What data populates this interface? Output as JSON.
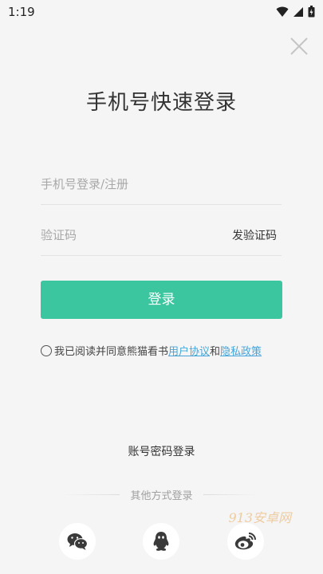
{
  "status_bar": {
    "time": "1:19"
  },
  "header": {
    "title": "手机号快速登录"
  },
  "form": {
    "phone_placeholder": "手机号登录/注册",
    "code_placeholder": "验证码",
    "send_code_label": "发验证码",
    "login_label": "登录"
  },
  "agreement": {
    "prefix": "我已阅读并同意熊猫看书",
    "user_agreement": "用户协议",
    "conjunction": "和",
    "privacy_policy": "隐私政策"
  },
  "alt_login": {
    "account_login_label": "账号密码登录",
    "other_methods_label": "其他方式登录",
    "methods": [
      "wechat-icon",
      "qq-icon",
      "weibo-icon"
    ]
  },
  "watermark": "913安卓网",
  "colors": {
    "accent": "#3cc6a0",
    "link": "#46a5d8",
    "background": "#f5f5f5"
  }
}
